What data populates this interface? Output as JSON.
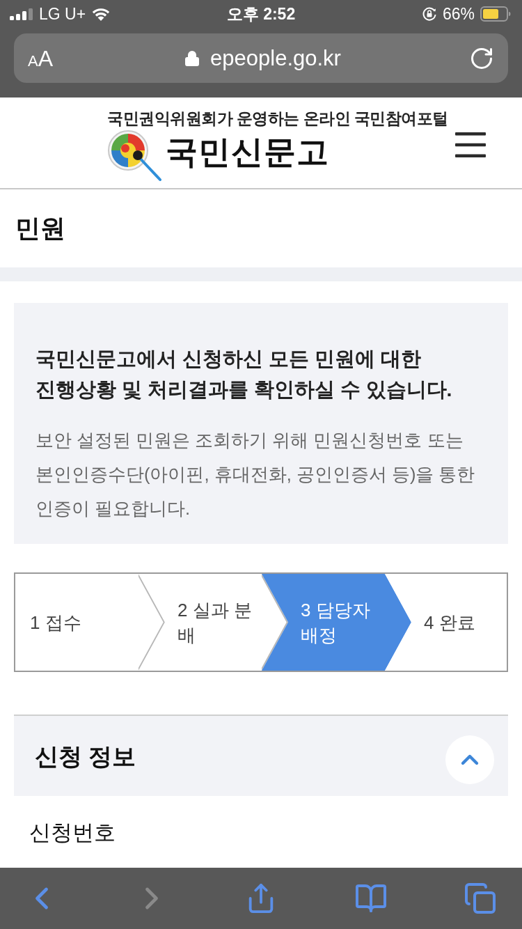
{
  "status_bar": {
    "carrier": "LG U+",
    "time": "오후 2:52",
    "battery": "66%"
  },
  "browser_bar": {
    "reader_button": "AA",
    "url": "epeople.go.kr",
    "secure": true
  },
  "site_header": {
    "tagline": "국민권익위원회가 운영하는 온라인 국민참여포털",
    "brand": "국민신문고"
  },
  "page_title": "민원",
  "notice": {
    "heading": "국민신문고에서 신청하신 모든 민원에 대한\n진행상황 및 처리결과를 확인하실 수 있습니다.",
    "body": "보안 설정된 민원은 조회하기 위해 민원신청번호 또는 본인인증수단(아이핀, 휴대전화, 공인인증서 등)을 통한 인증이 필요합니다."
  },
  "progress_steps": [
    {
      "label": "1 접수",
      "selected": false
    },
    {
      "label": "2 실과 분배",
      "selected": false
    },
    {
      "label": "3 담당자 배정",
      "selected": true
    },
    {
      "label": "4 완료",
      "selected": false
    }
  ],
  "section": {
    "title": "신청 정보",
    "expanded": true,
    "fields": [
      {
        "label": "신청번호"
      }
    ]
  },
  "toolbar": [
    {
      "kind": "back",
      "disabled": false
    },
    {
      "kind": "forward",
      "disabled": true
    },
    {
      "kind": "share",
      "disabled": false
    },
    {
      "kind": "bookmarks",
      "disabled": false
    },
    {
      "kind": "tabs",
      "disabled": false
    }
  ]
}
